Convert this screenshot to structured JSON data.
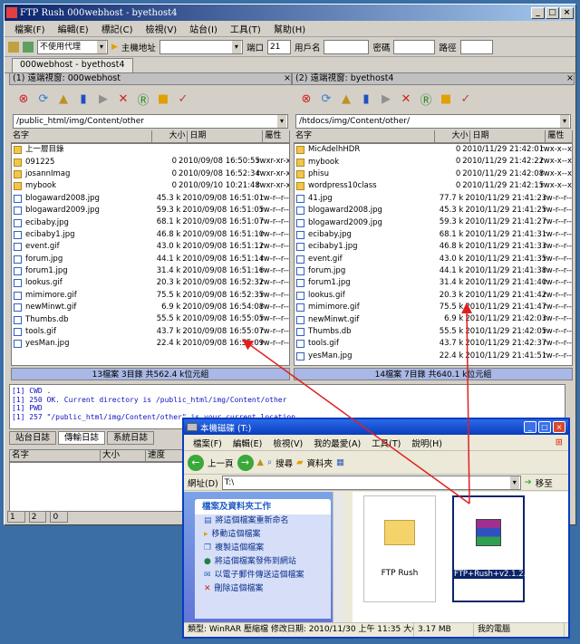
{
  "app": {
    "title": "FTP Rush  000webhost - byethost4"
  },
  "menu": [
    "檔案(F)",
    "編輯(E)",
    "標記(C)",
    "檢視(V)",
    "站台(I)",
    "工具(T)",
    "幫助(H)"
  ],
  "conn": {
    "proxy": "不使用代理",
    "host_label": "主機地址",
    "port_label": "端口",
    "port": "21",
    "user_label": "用戶名",
    "pass_label": "密碼",
    "path_label": "路徑"
  },
  "session_tab": "000webhost - byethost4",
  "left": {
    "header": "(1) 遠端視窗: 000webhost",
    "path": "/public_html/img/Content/other",
    "cols": [
      "名字",
      "大小",
      "日期",
      "屬性"
    ],
    "rows": [
      {
        "n": "上一層目錄",
        "s": "",
        "d": "",
        "a": "",
        "t": "up"
      },
      {
        "n": "091225",
        "s": "0",
        "d": "2010/09/08 16:50:55",
        "a": "rwxr-xr-x",
        "t": "fold"
      },
      {
        "n": "josannImag",
        "s": "0",
        "d": "2010/09/08 16:52:34",
        "a": "rwxr-xr-x",
        "t": "fold"
      },
      {
        "n": "mybook",
        "s": "0",
        "d": "2010/09/10 10:21:48",
        "a": "rwxr-xr-x",
        "t": "fold"
      },
      {
        "n": "blogaward2008.jpg",
        "s": "45.3 k",
        "d": "2010/09/08 16:51:01",
        "a": "rw-r--r--",
        "t": "file"
      },
      {
        "n": "blogaward2009.jpg",
        "s": "59.3 k",
        "d": "2010/09/08 16:51:05",
        "a": "rw-r--r--",
        "t": "file"
      },
      {
        "n": "ecibaby.jpg",
        "s": "68.1 k",
        "d": "2010/09/08 16:51:07",
        "a": "rw-r--r--",
        "t": "file"
      },
      {
        "n": "ecibaby1.jpg",
        "s": "46.8 k",
        "d": "2010/09/08 16:51:10",
        "a": "rw-r--r--",
        "t": "file"
      },
      {
        "n": "event.gif",
        "s": "43.0 k",
        "d": "2010/09/08 16:51:12",
        "a": "rw-r--r--",
        "t": "file"
      },
      {
        "n": "forum.jpg",
        "s": "44.1 k",
        "d": "2010/09/08 16:51:14",
        "a": "rw-r--r--",
        "t": "file"
      },
      {
        "n": "forum1.jpg",
        "s": "31.4 k",
        "d": "2010/09/08 16:51:16",
        "a": "rw-r--r--",
        "t": "file"
      },
      {
        "n": "lookus.gif",
        "s": "20.3 k",
        "d": "2010/09/08 16:52:32",
        "a": "rw-r--r--",
        "t": "file"
      },
      {
        "n": "mimimore.gif",
        "s": "75.5 k",
        "d": "2010/09/08 16:52:35",
        "a": "rw-r--r--",
        "t": "file"
      },
      {
        "n": "newMinwt.gif",
        "s": "6.9 k",
        "d": "2010/09/08 16:54:08",
        "a": "rw-r--r--",
        "t": "file"
      },
      {
        "n": "Thumbs.db",
        "s": "55.5 k",
        "d": "2010/09/08 16:55:05",
        "a": "rw-r--r--",
        "t": "file"
      },
      {
        "n": "tools.gif",
        "s": "43.7 k",
        "d": "2010/09/08 16:55:07",
        "a": "rw-r--r--",
        "t": "file"
      },
      {
        "n": "yesMan.jpg",
        "s": "22.4 k",
        "d": "2010/09/08 16:55:09",
        "a": "rw-r--r--",
        "t": "file"
      }
    ],
    "status": "13檔案 3目錄 共562.4 k位元組"
  },
  "right": {
    "header": "(2) 遠端視窗: byethost4",
    "path": "/htdocs/img/Content/other/",
    "cols": [
      "名字",
      "大小",
      "日期",
      "屬性"
    ],
    "rows": [
      {
        "n": "MicAdelhHDR",
        "s": "0",
        "d": "2010/11/29 21:42:01",
        "a": "rwx-x--x",
        "t": "fold"
      },
      {
        "n": "mybook",
        "s": "0",
        "d": "2010/11/29 21:42:22",
        "a": "rwx-x--x",
        "t": "fold"
      },
      {
        "n": "phisu",
        "s": "0",
        "d": "2010/11/29 21:42:08",
        "a": "rwx-x--x",
        "t": "fold"
      },
      {
        "n": "wordpress10class",
        "s": "0",
        "d": "2010/11/29 21:42:15",
        "a": "rwx-x--x",
        "t": "fold"
      },
      {
        "n": "41.jpg",
        "s": "77.7 k",
        "d": "2010/11/29 21:41:23",
        "a": "rw-r--r--",
        "t": "file"
      },
      {
        "n": "blogaward2008.jpg",
        "s": "45.3 k",
        "d": "2010/11/29 21:41:25",
        "a": "rw-r--r--",
        "t": "file"
      },
      {
        "n": "blogaward2009.jpg",
        "s": "59.3 k",
        "d": "2010/11/29 21:41:27",
        "a": "rw-r--r--",
        "t": "file"
      },
      {
        "n": "ecibaby.jpg",
        "s": "68.1 k",
        "d": "2010/11/29 21:41:31",
        "a": "rw-r--r--",
        "t": "file"
      },
      {
        "n": "ecibaby1.jpg",
        "s": "46.8 k",
        "d": "2010/11/29 21:41:33",
        "a": "rw-r--r--",
        "t": "file"
      },
      {
        "n": "event.gif",
        "s": "43.0 k",
        "d": "2010/11/29 21:41:35",
        "a": "rw-r--r--",
        "t": "file"
      },
      {
        "n": "forum.jpg",
        "s": "44.1 k",
        "d": "2010/11/29 21:41:38",
        "a": "rw-r--r--",
        "t": "file"
      },
      {
        "n": "forum1.jpg",
        "s": "31.4 k",
        "d": "2010/11/29 21:41:40",
        "a": "rw-r--r--",
        "t": "file"
      },
      {
        "n": "lookus.gif",
        "s": "20.3 k",
        "d": "2010/11/29 21:41:42",
        "a": "rw-r--r--",
        "t": "file"
      },
      {
        "n": "mimimore.gif",
        "s": "75.5 k",
        "d": "2010/11/29 21:41:47",
        "a": "rw-r--r--",
        "t": "file"
      },
      {
        "n": "newMinwt.gif",
        "s": "6.9 k",
        "d": "2010/11/29 21:42:03",
        "a": "rw-r--r--",
        "t": "file"
      },
      {
        "n": "Thumbs.db",
        "s": "55.5 k",
        "d": "2010/11/29 21:42:05",
        "a": "rw-r--r--",
        "t": "file"
      },
      {
        "n": "tools.gif",
        "s": "43.7 k",
        "d": "2010/11/29 21:42:37",
        "a": "rw-r--r--",
        "t": "file"
      },
      {
        "n": "yesMan.jpg",
        "s": "22.4 k",
        "d": "2010/11/29 21:41:51",
        "a": "rw-r--r--",
        "t": "file"
      }
    ],
    "status": "14檔案 7目錄 共640.1 k位元組"
  },
  "log": [
    "[1] CWD .",
    "[1] 250 OK. Current directory is /public_html/img/Content/other",
    "[1] PWD",
    "[1] 257 \"/public_html/img/Content/other\" is your current location"
  ],
  "bottom_tabs": [
    "站台日誌",
    "傳輸日誌",
    "系統日誌"
  ],
  "queue_cols": [
    "名字",
    "大小",
    "速度"
  ],
  "statusbar": [
    "1",
    "2",
    "0"
  ],
  "explorer": {
    "title": "本機磁碟 (T:)",
    "menu": [
      "檔案(F)",
      "編輯(E)",
      "檢視(V)",
      "我的最愛(A)",
      "工具(T)",
      "說明(H)"
    ],
    "back": "上一頁",
    "search": "搜尋",
    "folders": "資料夾",
    "addr_label": "網址(D)",
    "addr": "T:\\",
    "go": "移至",
    "tasks_title": "檔案及資料夾工作",
    "tasks": [
      "將這個檔案重新命名",
      "移動這個檔案",
      "複製這個檔案",
      "將這個檔案發佈到網站",
      "以電子郵件傳送這個檔案",
      "刪除這個檔案"
    ],
    "items": [
      "FTP Rush",
      "FTP+Rush+v2.1.2.7z"
    ],
    "status": [
      "類型: WinRAR 壓縮檔 修改日期: 2010/11/30 上午 11:35 大小:",
      "3.17 MB",
      "我的電腦"
    ]
  }
}
